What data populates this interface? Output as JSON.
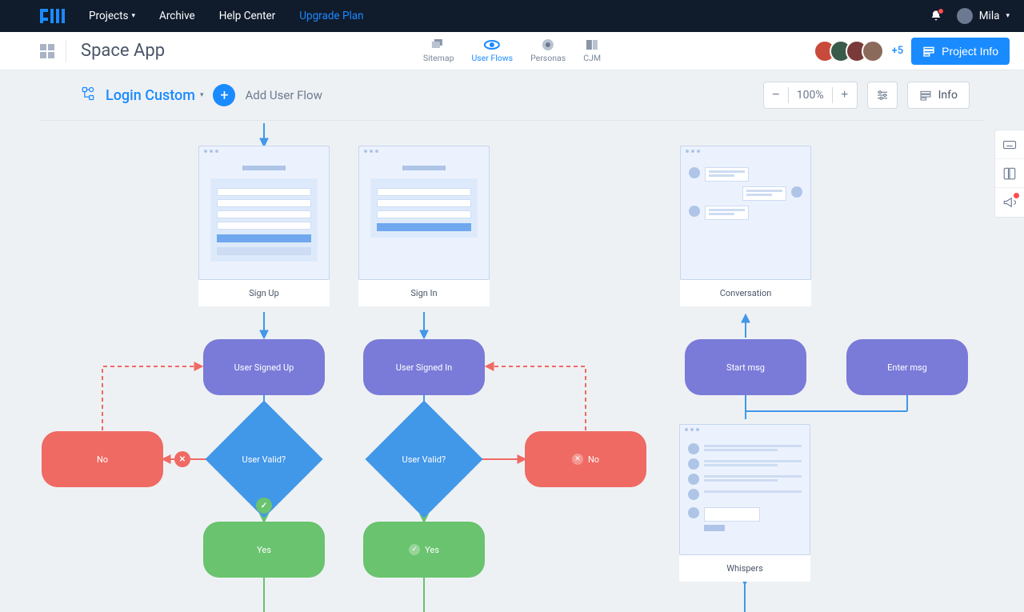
{
  "nav": {
    "projects": "Projects",
    "archive": "Archive",
    "help": "Help Center",
    "upgrade": "Upgrade Plan",
    "user": "Mila"
  },
  "project": {
    "title": "Space App",
    "tabs": {
      "sitemap": "Sitemap",
      "userflows": "User Flows",
      "personas": "Personas",
      "cjm": "CJM"
    },
    "collab_plus": "+5",
    "info_btn": "Project Info"
  },
  "flowbar": {
    "flow_name": "Login Custom",
    "add_label": "Add User Flow",
    "zoom": "100%",
    "info": "Info"
  },
  "nodes": {
    "signup": "Sign Up",
    "signin": "Sign In",
    "conversation": "Conversation",
    "user_signed_up": "User Signed Up",
    "user_signed_in": "User Signed In",
    "start_msg": "Start msg",
    "enter_msg": "Enter msg",
    "user_valid1": "User Valid?",
    "user_valid2": "User Valid?",
    "whispers": "Whispers",
    "no1": "No",
    "no2": "No",
    "yes1": "Yes",
    "yes2": "Yes"
  },
  "colors": {
    "blue": "#1a8bff",
    "purple": "#7a7ad9",
    "green": "#6ac36e",
    "red": "#ef6a63",
    "diamond": "#4197e8"
  }
}
